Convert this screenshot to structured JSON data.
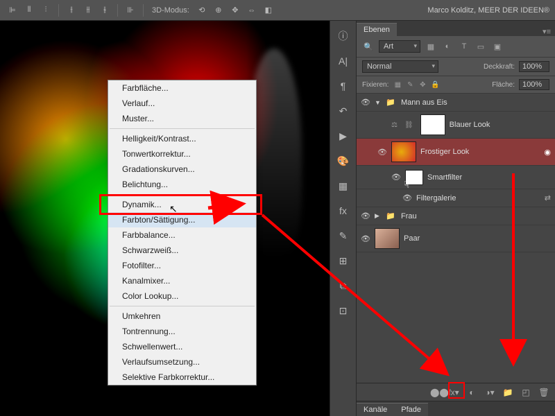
{
  "toolbar": {
    "mode3d_label": "3D-Modus:",
    "user": "Marco Kolditz, MEER DER IDEEN®"
  },
  "context_menu": {
    "group1": [
      "Farbfläche...",
      "Verlauf...",
      "Muster..."
    ],
    "group2": [
      "Helligkeit/Kontrast...",
      "Tonwertkorrektur...",
      "Gradationskurven...",
      "Belichtung..."
    ],
    "group3": [
      "Dynamik...",
      "Farbton/Sättigung...",
      "Farbbalance...",
      "Schwarzweiß...",
      "Fotofilter...",
      "Kanalmixer...",
      "Color Lookup..."
    ],
    "group4": [
      "Umkehren",
      "Tontrennung...",
      "Schwellenwert...",
      "Verlaufsumsetzung...",
      "Selektive Farbkorrektur..."
    ],
    "highlighted": "Farbton/Sättigung..."
  },
  "layers_panel": {
    "tab": "Ebenen",
    "search": "Art",
    "blend_mode": "Normal",
    "opacity_label": "Deckkraft:",
    "opacity": "100%",
    "lock_label": "Fixieren:",
    "fill_label": "Fläche:",
    "fill": "100%",
    "items": {
      "group_mann": "Mann aus Eis",
      "blauer_look": "Blauer Look",
      "frostiger_look": "Frostiger Look",
      "smartfilter": "Smartfilter",
      "filtergalerie": "Filtergalerie",
      "group_frau": "Frau",
      "paar": "Paar"
    }
  },
  "bottom_tabs": {
    "kanale": "Kanäle",
    "pfade": "Pfade"
  }
}
